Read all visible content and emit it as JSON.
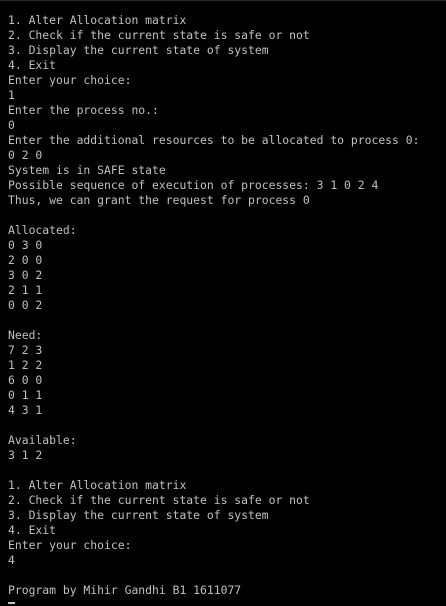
{
  "terminal": {
    "lines": [
      "1. Alter Allocation matrix",
      "2. Check if the current state is safe or not",
      "3. Display the current state of system",
      "4. Exit",
      "Enter your choice:",
      "1",
      "Enter the process no.:",
      "0",
      "Enter the additional resources to be allocated to process 0:",
      "0 2 0",
      "System is in SAFE state",
      "Possible sequence of execution of processes: 3 1 0 2 4",
      "Thus, we can grant the request for process 0",
      "",
      "Allocated:",
      "0 3 0",
      "2 0 0",
      "3 0 2",
      "2 1 1",
      "0 0 2",
      "",
      "Need:",
      "7 2 3",
      "1 2 2",
      "6 0 0",
      "0 1 1",
      "4 3 1",
      "",
      "Available:",
      "3 1 2",
      "",
      "1. Alter Allocation matrix",
      "2. Check if the current state is safe or not",
      "3. Display the current state of system",
      "4. Exit",
      "Enter your choice:",
      "4",
      "",
      "Program by Mihir Gandhi B1 1611077"
    ],
    "colors": {
      "background": "#000000",
      "text": "#c0c0c0"
    }
  }
}
